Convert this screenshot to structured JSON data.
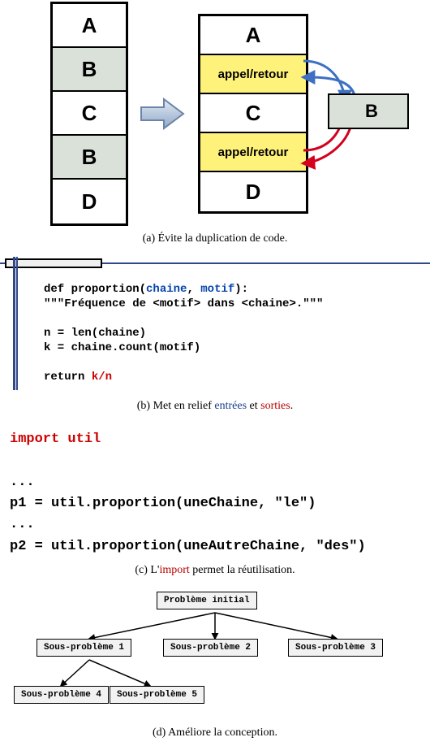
{
  "section_a": {
    "left_stack": [
      "A",
      "B",
      "C",
      "B",
      "D"
    ],
    "right_stack": {
      "a": "A",
      "appel1": "appel/retour",
      "c": "C",
      "appel2": "appel/retour",
      "d": "D"
    },
    "b_box": "B",
    "caption": "(a) Évite la duplication de code."
  },
  "section_b": {
    "code": {
      "def_kw": "def ",
      "fn_name": "proportion",
      "paren_open": "(",
      "param1": "chaine",
      "comma": ", ",
      "param2": "motif",
      "paren_close": "):",
      "docstring": "\"\"\"Fréquence de <motif> dans <chaine>.\"\"\"",
      "n_line": "n = len(chaine)",
      "k_line": "k = chaine.count(motif)",
      "return_kw": "return ",
      "return_expr": "k/n"
    },
    "caption_prefix": "(b) Met en relief ",
    "caption_entrees": "entrées",
    "caption_et": " et ",
    "caption_sorties": "sorties",
    "caption_period": "."
  },
  "section_c": {
    "import_kw": "import ",
    "import_mod": "util",
    "dots1": "...",
    "p1": "p1 = util.proportion(uneChaine, \"le\")",
    "dots2": "...",
    "p2": "p2 = util.proportion(uneAutreChaine, \"des\")",
    "caption_prefix": "(c) L'",
    "caption_import": "import",
    "caption_suffix": " permet la réutilisation."
  },
  "section_d": {
    "root": "Problème initial",
    "sp1": "Sous-problème 1",
    "sp2": "Sous-problème 2",
    "sp3": "Sous-problème 3",
    "sp4": "Sous-problème 4",
    "sp5": "Sous-problème 5",
    "caption": "(d) Améliore la conception."
  }
}
